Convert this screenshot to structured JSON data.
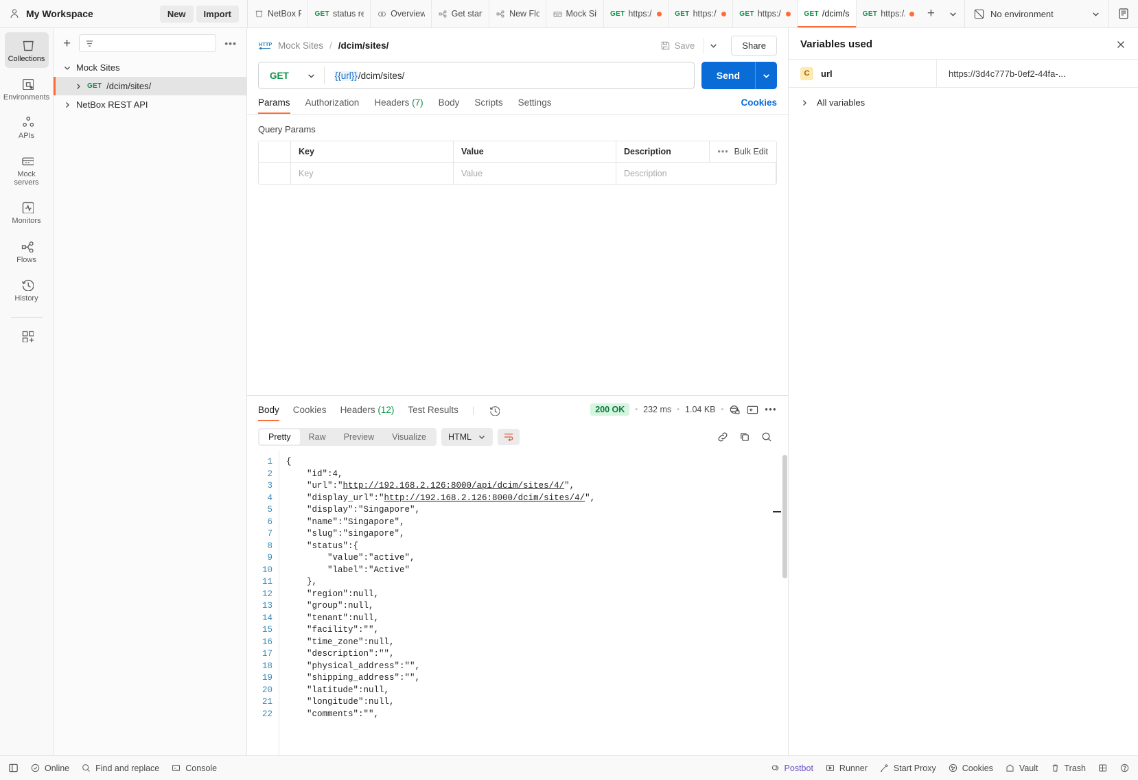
{
  "workspace": {
    "name": "My Workspace",
    "new_label": "New",
    "import_label": "Import"
  },
  "tabs": [
    {
      "label": "NetBox F",
      "icon": "collection-icon",
      "method": "",
      "dirty": false,
      "active": false
    },
    {
      "label": "status re",
      "icon": "",
      "method": "GET",
      "dirty": false,
      "active": false
    },
    {
      "label": "Overview",
      "icon": "overview-icon",
      "method": "",
      "dirty": false,
      "active": false
    },
    {
      "label": "Get start",
      "icon": "flow-icon",
      "method": "",
      "dirty": false,
      "active": false
    },
    {
      "label": "New Flo",
      "icon": "flow-icon",
      "method": "",
      "dirty": false,
      "active": false
    },
    {
      "label": "Mock Sit",
      "icon": "mock-icon",
      "method": "",
      "dirty": false,
      "active": false
    },
    {
      "label": "https://",
      "icon": "",
      "method": "GET",
      "dirty": true,
      "active": false
    },
    {
      "label": "https://",
      "icon": "",
      "method": "GET",
      "dirty": true,
      "active": false
    },
    {
      "label": "https://",
      "icon": "",
      "method": "GET",
      "dirty": true,
      "active": false
    },
    {
      "label": "/dcim/si",
      "icon": "",
      "method": "GET",
      "dirty": false,
      "active": true
    },
    {
      "label": "https://",
      "icon": "",
      "method": "GET",
      "dirty": true,
      "active": false
    }
  ],
  "environment": {
    "selected": "No environment"
  },
  "rail": [
    {
      "label": "Collections",
      "icon": "collections-icon",
      "active": true
    },
    {
      "label": "Environments",
      "icon": "environments-icon",
      "active": false
    },
    {
      "label": "APIs",
      "icon": "apis-icon",
      "active": false
    },
    {
      "label": "Mock servers",
      "icon": "mock-servers-icon",
      "active": false
    },
    {
      "label": "Monitors",
      "icon": "monitors-icon",
      "active": false
    },
    {
      "label": "Flows",
      "icon": "flows-icon",
      "active": false
    },
    {
      "label": "History",
      "icon": "history-icon",
      "active": false
    }
  ],
  "sidebar": {
    "filter_placeholder": "",
    "tree": [
      {
        "label": "Mock Sites",
        "method": "",
        "expanded": true,
        "selected": false,
        "indent": false
      },
      {
        "label": "/dcim/sites/",
        "method": "GET",
        "expanded": false,
        "selected": true,
        "indent": true
      },
      {
        "label": "NetBox REST API",
        "method": "",
        "expanded": false,
        "selected": false,
        "indent": false
      }
    ]
  },
  "request": {
    "breadcrumb_collection": "Mock Sites",
    "breadcrumb_sep": "/",
    "breadcrumb_name": "/dcim/sites/",
    "save_label": "Save",
    "share_label": "Share",
    "method": "GET",
    "url_variable": "{{url}}",
    "url_path": "/dcim/sites/",
    "send_label": "Send",
    "tabs": [
      {
        "label": "Params",
        "count": "",
        "active": true
      },
      {
        "label": "Authorization",
        "count": "",
        "active": false
      },
      {
        "label": "Headers",
        "count": "(7)",
        "active": false
      },
      {
        "label": "Body",
        "count": "",
        "active": false
      },
      {
        "label": "Scripts",
        "count": "",
        "active": false
      },
      {
        "label": "Settings",
        "count": "",
        "active": false
      }
    ],
    "cookies_link": "Cookies",
    "query_params": {
      "title": "Query Params",
      "columns": [
        "Key",
        "Value",
        "Description"
      ],
      "bulk_edit_label": "Bulk Edit",
      "placeholder_row": [
        "Key",
        "Value",
        "Description"
      ]
    }
  },
  "response": {
    "tabs": [
      {
        "label": "Body",
        "count": "",
        "active": true
      },
      {
        "label": "Cookies",
        "count": "",
        "active": false
      },
      {
        "label": "Headers",
        "count": "(12)",
        "active": false
      },
      {
        "label": "Test Results",
        "count": "",
        "active": false
      }
    ],
    "status": "200 OK",
    "time": "232 ms",
    "size": "1.04 KB",
    "formats": [
      {
        "label": "Pretty",
        "active": true
      },
      {
        "label": "Raw",
        "active": false
      },
      {
        "label": "Preview",
        "active": false
      },
      {
        "label": "Visualize",
        "active": false
      }
    ],
    "language": "HTML",
    "body_lines": [
      {
        "n": 1,
        "text": "{"
      },
      {
        "n": 2,
        "text": "    \"id\":4,"
      },
      {
        "n": 3,
        "text": "    \"url\":\"http://192.168.2.126:8000/api/dcim/sites/4/\","
      },
      {
        "n": 4,
        "text": "    \"display_url\":\"http://192.168.2.126:8000/dcim/sites/4/\","
      },
      {
        "n": 5,
        "text": "    \"display\":\"Singapore\","
      },
      {
        "n": 6,
        "text": "    \"name\":\"Singapore\","
      },
      {
        "n": 7,
        "text": "    \"slug\":\"singapore\","
      },
      {
        "n": 8,
        "text": "    \"status\":{"
      },
      {
        "n": 9,
        "text": "        \"value\":\"active\","
      },
      {
        "n": 10,
        "text": "        \"label\":\"Active\""
      },
      {
        "n": 11,
        "text": "    },"
      },
      {
        "n": 12,
        "text": "    \"region\":null,"
      },
      {
        "n": 13,
        "text": "    \"group\":null,"
      },
      {
        "n": 14,
        "text": "    \"tenant\":null,"
      },
      {
        "n": 15,
        "text": "    \"facility\":\"\","
      },
      {
        "n": 16,
        "text": "    \"time_zone\":null,"
      },
      {
        "n": 17,
        "text": "    \"description\":\"\","
      },
      {
        "n": 18,
        "text": "    \"physical_address\":\"\","
      },
      {
        "n": 19,
        "text": "    \"shipping_address\":\"\","
      },
      {
        "n": 20,
        "text": "    \"latitude\":null,"
      },
      {
        "n": 21,
        "text": "    \"longitude\":null,"
      },
      {
        "n": 22,
        "text": "    \"comments\":\"\","
      }
    ]
  },
  "variables_panel": {
    "title": "Variables used",
    "rows": [
      {
        "scope_badge": "C",
        "name": "url",
        "value": "https://3d4c777b-0ef2-44fa-..."
      }
    ],
    "all_variables_label": "All variables"
  },
  "statusbar": {
    "left": [
      {
        "label": "Online",
        "icon": "online-icon"
      },
      {
        "label": "Find and replace",
        "icon": "search-icon"
      },
      {
        "label": "Console",
        "icon": "console-icon"
      }
    ],
    "right": [
      {
        "label": "Postbot",
        "icon": "postbot-icon"
      },
      {
        "label": "Runner",
        "icon": "runner-icon"
      },
      {
        "label": "Start Proxy",
        "icon": "proxy-icon"
      },
      {
        "label": "Cookies",
        "icon": "cookies-icon"
      },
      {
        "label": "Vault",
        "icon": "vault-icon"
      },
      {
        "label": "Trash",
        "icon": "trash-icon"
      }
    ]
  },
  "colors": {
    "accent": "#ff6c37",
    "send": "#0a6cd7",
    "method_get": "#0a9247",
    "status_ok_bg": "#d6f5e0",
    "postbot": "#6b4fc4"
  }
}
